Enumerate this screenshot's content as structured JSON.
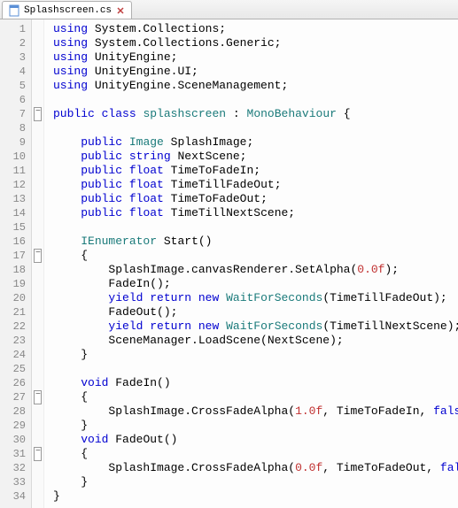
{
  "tab": {
    "filename": "Splashscreen.cs"
  },
  "code": {
    "lines": [
      [
        {
          "t": "kw",
          "v": "using"
        },
        {
          "t": "sp",
          "v": " "
        },
        {
          "t": "id",
          "v": "System.Collections;"
        }
      ],
      [
        {
          "t": "kw",
          "v": "using"
        },
        {
          "t": "sp",
          "v": " "
        },
        {
          "t": "id",
          "v": "System.Collections.Generic;"
        }
      ],
      [
        {
          "t": "kw",
          "v": "using"
        },
        {
          "t": "sp",
          "v": " "
        },
        {
          "t": "id",
          "v": "UnityEngine;"
        }
      ],
      [
        {
          "t": "kw",
          "v": "using"
        },
        {
          "t": "sp",
          "v": " "
        },
        {
          "t": "id",
          "v": "UnityEngine.UI;"
        }
      ],
      [
        {
          "t": "kw",
          "v": "using"
        },
        {
          "t": "sp",
          "v": " "
        },
        {
          "t": "id",
          "v": "UnityEngine.SceneManagement;"
        }
      ],
      [],
      [
        {
          "t": "kw",
          "v": "public"
        },
        {
          "t": "sp",
          "v": " "
        },
        {
          "t": "kw",
          "v": "class"
        },
        {
          "t": "sp",
          "v": " "
        },
        {
          "t": "ty",
          "v": "splashscreen"
        },
        {
          "t": "sp",
          "v": " "
        },
        {
          "t": "pn",
          "v": ":"
        },
        {
          "t": "sp",
          "v": " "
        },
        {
          "t": "ty",
          "v": "MonoBehaviour"
        },
        {
          "t": "sp",
          "v": " "
        },
        {
          "t": "pn",
          "v": "{"
        }
      ],
      [],
      [
        {
          "t": "sp",
          "v": "    "
        },
        {
          "t": "kw",
          "v": "public"
        },
        {
          "t": "sp",
          "v": " "
        },
        {
          "t": "ty",
          "v": "Image"
        },
        {
          "t": "sp",
          "v": " "
        },
        {
          "t": "id",
          "v": "SplashImage;"
        }
      ],
      [
        {
          "t": "sp",
          "v": "    "
        },
        {
          "t": "kw",
          "v": "public"
        },
        {
          "t": "sp",
          "v": " "
        },
        {
          "t": "kw",
          "v": "string"
        },
        {
          "t": "sp",
          "v": " "
        },
        {
          "t": "id",
          "v": "NextScene;"
        }
      ],
      [
        {
          "t": "sp",
          "v": "    "
        },
        {
          "t": "kw",
          "v": "public"
        },
        {
          "t": "sp",
          "v": " "
        },
        {
          "t": "kw",
          "v": "float"
        },
        {
          "t": "sp",
          "v": " "
        },
        {
          "t": "id",
          "v": "TimeToFadeIn;"
        }
      ],
      [
        {
          "t": "sp",
          "v": "    "
        },
        {
          "t": "kw",
          "v": "public"
        },
        {
          "t": "sp",
          "v": " "
        },
        {
          "t": "kw",
          "v": "float"
        },
        {
          "t": "sp",
          "v": " "
        },
        {
          "t": "id",
          "v": "TimeTillFadeOut;"
        }
      ],
      [
        {
          "t": "sp",
          "v": "    "
        },
        {
          "t": "kw",
          "v": "public"
        },
        {
          "t": "sp",
          "v": " "
        },
        {
          "t": "kw",
          "v": "float"
        },
        {
          "t": "sp",
          "v": " "
        },
        {
          "t": "id",
          "v": "TimeToFadeOut;"
        }
      ],
      [
        {
          "t": "sp",
          "v": "    "
        },
        {
          "t": "kw",
          "v": "public"
        },
        {
          "t": "sp",
          "v": " "
        },
        {
          "t": "kw",
          "v": "float"
        },
        {
          "t": "sp",
          "v": " "
        },
        {
          "t": "id",
          "v": "TimeTillNextScene;"
        }
      ],
      [],
      [
        {
          "t": "sp",
          "v": "    "
        },
        {
          "t": "ty",
          "v": "IEnumerator"
        },
        {
          "t": "sp",
          "v": " "
        },
        {
          "t": "id",
          "v": "Start()"
        }
      ],
      [
        {
          "t": "sp",
          "v": "    "
        },
        {
          "t": "pn",
          "v": "{"
        }
      ],
      [
        {
          "t": "sp",
          "v": "        "
        },
        {
          "t": "id",
          "v": "SplashImage.canvasRenderer.SetAlpha("
        },
        {
          "t": "nm",
          "v": "0.0f"
        },
        {
          "t": "id",
          "v": ");"
        }
      ],
      [
        {
          "t": "sp",
          "v": "        "
        },
        {
          "t": "id",
          "v": "FadeIn();"
        }
      ],
      [
        {
          "t": "sp",
          "v": "        "
        },
        {
          "t": "kw",
          "v": "yield"
        },
        {
          "t": "sp",
          "v": " "
        },
        {
          "t": "kw",
          "v": "return"
        },
        {
          "t": "sp",
          "v": " "
        },
        {
          "t": "kw",
          "v": "new"
        },
        {
          "t": "sp",
          "v": " "
        },
        {
          "t": "ty",
          "v": "WaitForSeconds"
        },
        {
          "t": "id",
          "v": "(TimeTillFadeOut);"
        }
      ],
      [
        {
          "t": "sp",
          "v": "        "
        },
        {
          "t": "id",
          "v": "FadeOut();"
        }
      ],
      [
        {
          "t": "sp",
          "v": "        "
        },
        {
          "t": "kw",
          "v": "yield"
        },
        {
          "t": "sp",
          "v": " "
        },
        {
          "t": "kw",
          "v": "return"
        },
        {
          "t": "sp",
          "v": " "
        },
        {
          "t": "kw",
          "v": "new"
        },
        {
          "t": "sp",
          "v": " "
        },
        {
          "t": "ty",
          "v": "WaitForSeconds"
        },
        {
          "t": "id",
          "v": "(TimeTillNextScene);"
        }
      ],
      [
        {
          "t": "sp",
          "v": "        "
        },
        {
          "t": "id",
          "v": "SceneManager.LoadScene(NextScene);"
        }
      ],
      [
        {
          "t": "sp",
          "v": "    "
        },
        {
          "t": "pn",
          "v": "}"
        }
      ],
      [],
      [
        {
          "t": "sp",
          "v": "    "
        },
        {
          "t": "kw",
          "v": "void"
        },
        {
          "t": "sp",
          "v": " "
        },
        {
          "t": "id",
          "v": "FadeIn()"
        }
      ],
      [
        {
          "t": "sp",
          "v": "    "
        },
        {
          "t": "pn",
          "v": "{"
        }
      ],
      [
        {
          "t": "sp",
          "v": "        "
        },
        {
          "t": "id",
          "v": "SplashImage.CrossFadeAlpha("
        },
        {
          "t": "nm",
          "v": "1.0f"
        },
        {
          "t": "id",
          "v": ", TimeToFadeIn, "
        },
        {
          "t": "kw",
          "v": "false"
        },
        {
          "t": "id",
          "v": ");"
        }
      ],
      [
        {
          "t": "sp",
          "v": "    "
        },
        {
          "t": "pn",
          "v": "}"
        }
      ],
      [
        {
          "t": "sp",
          "v": "    "
        },
        {
          "t": "kw",
          "v": "void"
        },
        {
          "t": "sp",
          "v": " "
        },
        {
          "t": "id",
          "v": "FadeOut()"
        }
      ],
      [
        {
          "t": "sp",
          "v": "    "
        },
        {
          "t": "pn",
          "v": "{"
        }
      ],
      [
        {
          "t": "sp",
          "v": "        "
        },
        {
          "t": "id",
          "v": "SplashImage.CrossFadeAlpha("
        },
        {
          "t": "nm",
          "v": "0.0f"
        },
        {
          "t": "id",
          "v": ", TimeToFadeOut, "
        },
        {
          "t": "kw",
          "v": "false"
        },
        {
          "t": "id",
          "v": ");"
        }
      ],
      [
        {
          "t": "sp",
          "v": "    "
        },
        {
          "t": "pn",
          "v": "}"
        }
      ],
      [
        {
          "t": "pn",
          "v": "}"
        }
      ]
    ],
    "fold_marks": {
      "7": true,
      "17": true,
      "27": true,
      "31": true
    }
  }
}
